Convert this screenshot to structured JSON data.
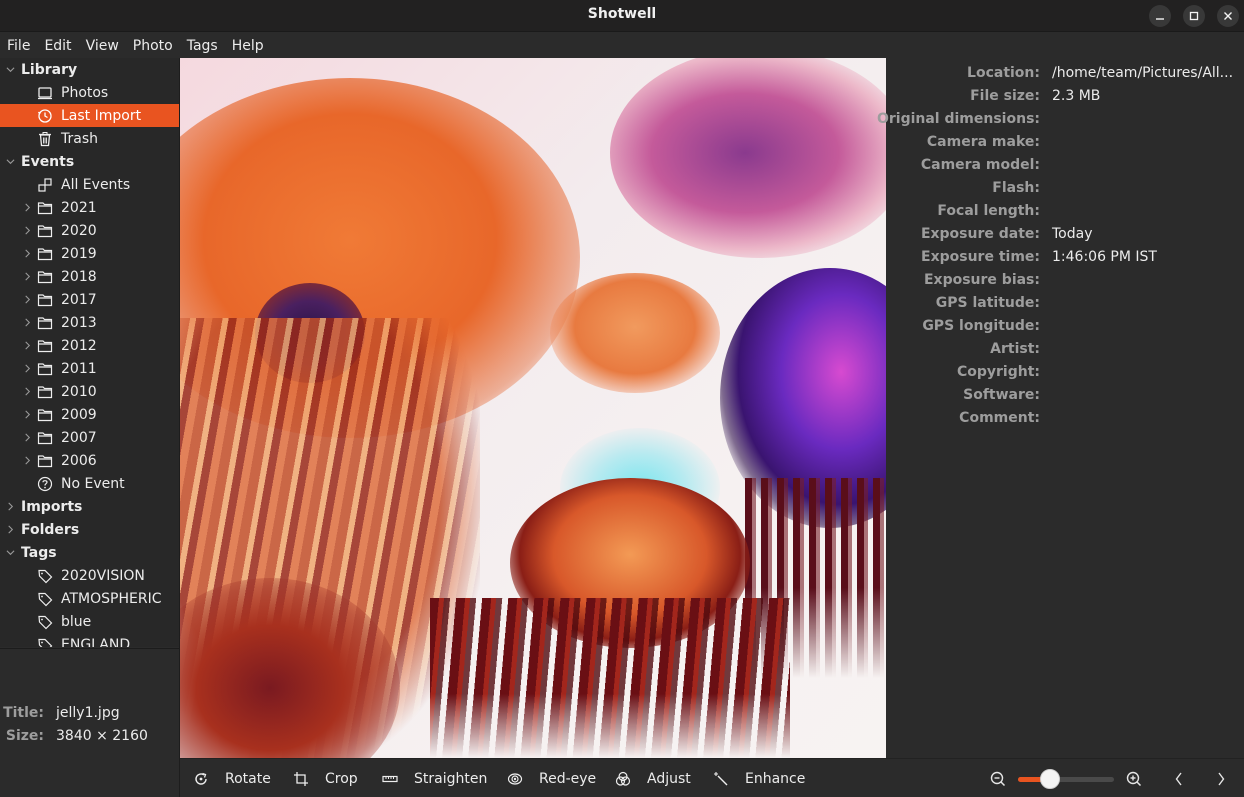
{
  "window": {
    "title": "Shotwell",
    "controls": [
      "minimize",
      "maximize",
      "close"
    ]
  },
  "menubar": [
    "File",
    "Edit",
    "View",
    "Photo",
    "Tags",
    "Help"
  ],
  "sidebar": {
    "library": {
      "label": "Library",
      "items": [
        {
          "label": "Photos",
          "icon": "photos-icon"
        },
        {
          "label": "Last Import",
          "icon": "clock-icon",
          "selected": true
        },
        {
          "label": "Trash",
          "icon": "trash-icon"
        }
      ]
    },
    "events": {
      "label": "Events",
      "all_events": "All Events",
      "years": [
        "2021",
        "2020",
        "2019",
        "2018",
        "2017",
        "2013",
        "2012",
        "2011",
        "2010",
        "2009",
        "2007",
        "2006"
      ],
      "no_event": "No Event"
    },
    "imports": {
      "label": "Imports"
    },
    "folders": {
      "label": "Folders"
    },
    "tags": {
      "label": "Tags",
      "items": [
        "2020VISION",
        "ATMOSPHERIC",
        "blue",
        "ENGLAND"
      ]
    },
    "info": {
      "title_label": "Title:",
      "title_value": "jelly1.jpg",
      "size_label": "Size:",
      "size_value": "3840 × 2160"
    }
  },
  "properties": [
    {
      "label": "Location:",
      "value": "/home/team/Pictures/All..."
    },
    {
      "label": "File size:",
      "value": "2.3 MB"
    },
    {
      "label": "Original dimensions:",
      "value": ""
    },
    {
      "label": "Camera make:",
      "value": ""
    },
    {
      "label": "Camera model:",
      "value": ""
    },
    {
      "label": "Flash:",
      "value": ""
    },
    {
      "label": "Focal length:",
      "value": ""
    },
    {
      "label": "Exposure date:",
      "value": "Today"
    },
    {
      "label": "Exposure time:",
      "value": "1:46:06 PM IST"
    },
    {
      "label": "Exposure bias:",
      "value": ""
    },
    {
      "label": "GPS latitude:",
      "value": ""
    },
    {
      "label": "GPS longitude:",
      "value": ""
    },
    {
      "label": "Artist:",
      "value": ""
    },
    {
      "label": "Copyright:",
      "value": ""
    },
    {
      "label": "Software:",
      "value": ""
    },
    {
      "label": "Comment:",
      "value": ""
    }
  ],
  "toolbar": {
    "rotate": "Rotate",
    "crop": "Crop",
    "straighten": "Straighten",
    "redeye": "Red-eye",
    "adjust": "Adjust",
    "enhance": "Enhance",
    "zoom_level": 0.27
  },
  "colors": {
    "accent": "#e95420",
    "background": "#2b2b2b",
    "titlebar": "#222121",
    "label_muted": "#9d9d9d"
  }
}
